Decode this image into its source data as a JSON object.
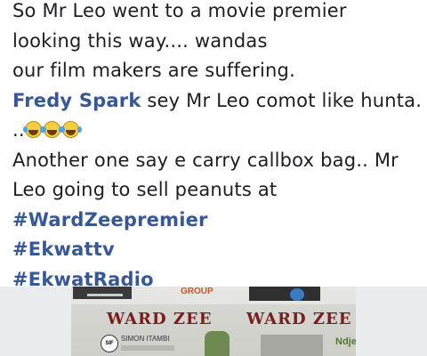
{
  "post": {
    "line1": "So Mr Leo went to a movie premier",
    "line2": "looking this way.... wandas",
    "line3": "our film makers are suffering.",
    "mention": "Fredy Spark",
    "line4_rest": " sey Mr Leo comot like hunta.",
    "line5_prefix": "..",
    "emojis": [
      "tears-of-joy-emoji",
      "tears-of-joy-emoji",
      "tears-of-joy-emoji"
    ],
    "line6": "Another one say e carry callbox bag.. Mr",
    "line7": "Leo going to sell peanuts at",
    "hashtags": [
      "#WardZeepremier",
      "#Ekwattv",
      "#EkwatRadio"
    ]
  },
  "photo": {
    "banner_word_left": "WARD ZEE",
    "banner_word_right": "WARD ZEE",
    "group_label": "GROUP",
    "sif_label": "SIF",
    "sponsor_name": "SIMON ITAMBI",
    "right_logo_text": "Ndje",
    "colors": {
      "mention": "#365899",
      "hashtag": "#365899",
      "text": "#1c1e21"
    }
  }
}
